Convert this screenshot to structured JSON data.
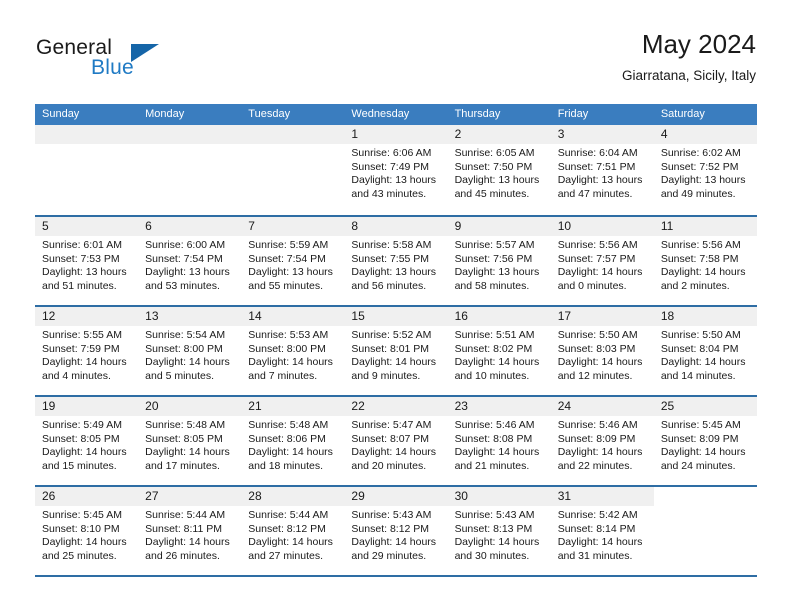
{
  "brand": {
    "name_part1": "General",
    "name_part2": "Blue",
    "logo_icon": "blue-triangle-logo"
  },
  "header": {
    "title": "May 2024",
    "location": "Giarratana, Sicily, Italy"
  },
  "colors": {
    "header_blue": "#3a7dbf",
    "rule_blue": "#2e6da4",
    "daynum_bg": "#f0f0f0",
    "brand_blue": "#1f7ac4",
    "text": "#1a1a1a",
    "page_bg": "#ffffff"
  },
  "calendar": {
    "weekday_headers": [
      "Sunday",
      "Monday",
      "Tuesday",
      "Wednesday",
      "Thursday",
      "Friday",
      "Saturday"
    ],
    "labels": {
      "sunrise": "Sunrise:",
      "sunset": "Sunset:",
      "daylight": "Daylight:"
    },
    "weeks": [
      [
        {
          "day": "",
          "state": "empty-stripe",
          "sunrise": "",
          "sunset": "",
          "daylight_line1": "",
          "daylight_line2": ""
        },
        {
          "day": "",
          "state": "empty-stripe",
          "sunrise": "",
          "sunset": "",
          "daylight_line1": "",
          "daylight_line2": ""
        },
        {
          "day": "",
          "state": "empty-stripe",
          "sunrise": "",
          "sunset": "",
          "daylight_line1": "",
          "daylight_line2": ""
        },
        {
          "day": "1",
          "state": "filled",
          "sunrise": "Sunrise: 6:06 AM",
          "sunset": "Sunset: 7:49 PM",
          "daylight_line1": "Daylight: 13 hours",
          "daylight_line2": "and 43 minutes."
        },
        {
          "day": "2",
          "state": "filled",
          "sunrise": "Sunrise: 6:05 AM",
          "sunset": "Sunset: 7:50 PM",
          "daylight_line1": "Daylight: 13 hours",
          "daylight_line2": "and 45 minutes."
        },
        {
          "day": "3",
          "state": "filled",
          "sunrise": "Sunrise: 6:04 AM",
          "sunset": "Sunset: 7:51 PM",
          "daylight_line1": "Daylight: 13 hours",
          "daylight_line2": "and 47 minutes."
        },
        {
          "day": "4",
          "state": "filled",
          "sunrise": "Sunrise: 6:02 AM",
          "sunset": "Sunset: 7:52 PM",
          "daylight_line1": "Daylight: 13 hours",
          "daylight_line2": "and 49 minutes."
        }
      ],
      [
        {
          "day": "5",
          "state": "filled",
          "sunrise": "Sunrise: 6:01 AM",
          "sunset": "Sunset: 7:53 PM",
          "daylight_line1": "Daylight: 13 hours",
          "daylight_line2": "and 51 minutes."
        },
        {
          "day": "6",
          "state": "filled",
          "sunrise": "Sunrise: 6:00 AM",
          "sunset": "Sunset: 7:54 PM",
          "daylight_line1": "Daylight: 13 hours",
          "daylight_line2": "and 53 minutes."
        },
        {
          "day": "7",
          "state": "filled",
          "sunrise": "Sunrise: 5:59 AM",
          "sunset": "Sunset: 7:54 PM",
          "daylight_line1": "Daylight: 13 hours",
          "daylight_line2": "and 55 minutes."
        },
        {
          "day": "8",
          "state": "filled",
          "sunrise": "Sunrise: 5:58 AM",
          "sunset": "Sunset: 7:55 PM",
          "daylight_line1": "Daylight: 13 hours",
          "daylight_line2": "and 56 minutes."
        },
        {
          "day": "9",
          "state": "filled",
          "sunrise": "Sunrise: 5:57 AM",
          "sunset": "Sunset: 7:56 PM",
          "daylight_line1": "Daylight: 13 hours",
          "daylight_line2": "and 58 minutes."
        },
        {
          "day": "10",
          "state": "filled",
          "sunrise": "Sunrise: 5:56 AM",
          "sunset": "Sunset: 7:57 PM",
          "daylight_line1": "Daylight: 14 hours",
          "daylight_line2": "and 0 minutes."
        },
        {
          "day": "11",
          "state": "filled",
          "sunrise": "Sunrise: 5:56 AM",
          "sunset": "Sunset: 7:58 PM",
          "daylight_line1": "Daylight: 14 hours",
          "daylight_line2": "and 2 minutes."
        }
      ],
      [
        {
          "day": "12",
          "state": "filled",
          "sunrise": "Sunrise: 5:55 AM",
          "sunset": "Sunset: 7:59 PM",
          "daylight_line1": "Daylight: 14 hours",
          "daylight_line2": "and 4 minutes."
        },
        {
          "day": "13",
          "state": "filled",
          "sunrise": "Sunrise: 5:54 AM",
          "sunset": "Sunset: 8:00 PM",
          "daylight_line1": "Daylight: 14 hours",
          "daylight_line2": "and 5 minutes."
        },
        {
          "day": "14",
          "state": "filled",
          "sunrise": "Sunrise: 5:53 AM",
          "sunset": "Sunset: 8:00 PM",
          "daylight_line1": "Daylight: 14 hours",
          "daylight_line2": "and 7 minutes."
        },
        {
          "day": "15",
          "state": "filled",
          "sunrise": "Sunrise: 5:52 AM",
          "sunset": "Sunset: 8:01 PM",
          "daylight_line1": "Daylight: 14 hours",
          "daylight_line2": "and 9 minutes."
        },
        {
          "day": "16",
          "state": "filled",
          "sunrise": "Sunrise: 5:51 AM",
          "sunset": "Sunset: 8:02 PM",
          "daylight_line1": "Daylight: 14 hours",
          "daylight_line2": "and 10 minutes."
        },
        {
          "day": "17",
          "state": "filled",
          "sunrise": "Sunrise: 5:50 AM",
          "sunset": "Sunset: 8:03 PM",
          "daylight_line1": "Daylight: 14 hours",
          "daylight_line2": "and 12 minutes."
        },
        {
          "day": "18",
          "state": "filled",
          "sunrise": "Sunrise: 5:50 AM",
          "sunset": "Sunset: 8:04 PM",
          "daylight_line1": "Daylight: 14 hours",
          "daylight_line2": "and 14 minutes."
        }
      ],
      [
        {
          "day": "19",
          "state": "filled",
          "sunrise": "Sunrise: 5:49 AM",
          "sunset": "Sunset: 8:05 PM",
          "daylight_line1": "Daylight: 14 hours",
          "daylight_line2": "and 15 minutes."
        },
        {
          "day": "20",
          "state": "filled",
          "sunrise": "Sunrise: 5:48 AM",
          "sunset": "Sunset: 8:05 PM",
          "daylight_line1": "Daylight: 14 hours",
          "daylight_line2": "and 17 minutes."
        },
        {
          "day": "21",
          "state": "filled",
          "sunrise": "Sunrise: 5:48 AM",
          "sunset": "Sunset: 8:06 PM",
          "daylight_line1": "Daylight: 14 hours",
          "daylight_line2": "and 18 minutes."
        },
        {
          "day": "22",
          "state": "filled",
          "sunrise": "Sunrise: 5:47 AM",
          "sunset": "Sunset: 8:07 PM",
          "daylight_line1": "Daylight: 14 hours",
          "daylight_line2": "and 20 minutes."
        },
        {
          "day": "23",
          "state": "filled",
          "sunrise": "Sunrise: 5:46 AM",
          "sunset": "Sunset: 8:08 PM",
          "daylight_line1": "Daylight: 14 hours",
          "daylight_line2": "and 21 minutes."
        },
        {
          "day": "24",
          "state": "filled",
          "sunrise": "Sunrise: 5:46 AM",
          "sunset": "Sunset: 8:09 PM",
          "daylight_line1": "Daylight: 14 hours",
          "daylight_line2": "and 22 minutes."
        },
        {
          "day": "25",
          "state": "filled",
          "sunrise": "Sunrise: 5:45 AM",
          "sunset": "Sunset: 8:09 PM",
          "daylight_line1": "Daylight: 14 hours",
          "daylight_line2": "and 24 minutes."
        }
      ],
      [
        {
          "day": "26",
          "state": "filled",
          "sunrise": "Sunrise: 5:45 AM",
          "sunset": "Sunset: 8:10 PM",
          "daylight_line1": "Daylight: 14 hours",
          "daylight_line2": "and 25 minutes."
        },
        {
          "day": "27",
          "state": "filled",
          "sunrise": "Sunrise: 5:44 AM",
          "sunset": "Sunset: 8:11 PM",
          "daylight_line1": "Daylight: 14 hours",
          "daylight_line2": "and 26 minutes."
        },
        {
          "day": "28",
          "state": "filled",
          "sunrise": "Sunrise: 5:44 AM",
          "sunset": "Sunset: 8:12 PM",
          "daylight_line1": "Daylight: 14 hours",
          "daylight_line2": "and 27 minutes."
        },
        {
          "day": "29",
          "state": "filled",
          "sunrise": "Sunrise: 5:43 AM",
          "sunset": "Sunset: 8:12 PM",
          "daylight_line1": "Daylight: 14 hours",
          "daylight_line2": "and 29 minutes."
        },
        {
          "day": "30",
          "state": "filled",
          "sunrise": "Sunrise: 5:43 AM",
          "sunset": "Sunset: 8:13 PM",
          "daylight_line1": "Daylight: 14 hours",
          "daylight_line2": "and 30 minutes."
        },
        {
          "day": "31",
          "state": "filled",
          "sunrise": "Sunrise: 5:42 AM",
          "sunset": "Sunset: 8:14 PM",
          "daylight_line1": "Daylight: 14 hours",
          "daylight_line2": "and 31 minutes."
        },
        {
          "day": "",
          "state": "blank",
          "sunrise": "",
          "sunset": "",
          "daylight_line1": "",
          "daylight_line2": ""
        }
      ]
    ]
  }
}
